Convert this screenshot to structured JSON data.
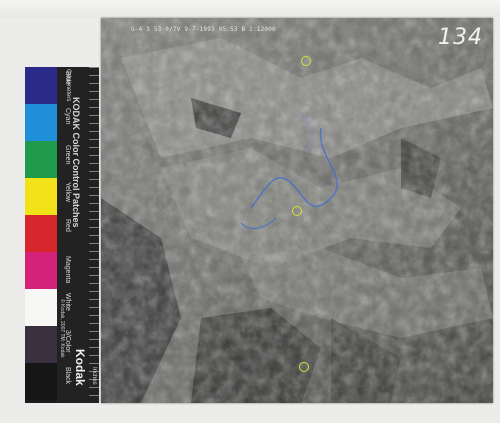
{
  "photo": {
    "header_text": "G-4 3  53-0/7V 9-7-1993 05:53 B 1:12000",
    "frame_number": "134"
  },
  "color_strip": {
    "title": "KODAK Color Control Patches",
    "brand": "Kodak",
    "small_print": "© Kodak, 2007 TM: Kodak",
    "centimeters_label": "Centimeters",
    "inches_label": "Inches",
    "patches": [
      {
        "name": "Blue",
        "color": "#2c2a8a"
      },
      {
        "name": "Cyan",
        "color": "#1e8fd8"
      },
      {
        "name": "Green",
        "color": "#1f9a4a"
      },
      {
        "name": "Yellow",
        "color": "#f1e21a"
      },
      {
        "name": "Red",
        "color": "#d8262d"
      },
      {
        "name": "Magenta",
        "color": "#d4217a"
      },
      {
        "name": "White",
        "color": "#f7f7f5"
      },
      {
        "name": "3/Color",
        "color": "#3a3040"
      },
      {
        "name": "Black",
        "color": "#161616"
      }
    ]
  }
}
